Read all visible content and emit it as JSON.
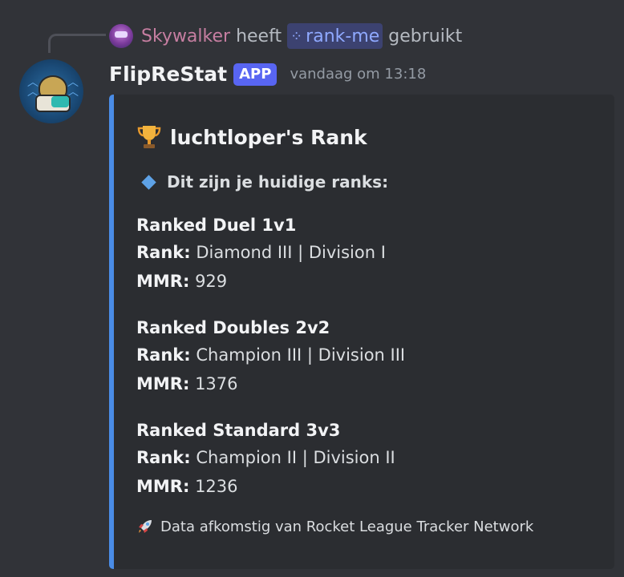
{
  "reply": {
    "user": "Skywalker",
    "verb": "heeft",
    "command": "rank-me",
    "used": "gebruikt"
  },
  "message": {
    "username": "FlipReStat",
    "badge": "APP",
    "timestamp": "vandaag om 13:18"
  },
  "embed": {
    "accent_color": "#4a8ce6",
    "title_icon": "trophy-icon",
    "title": "luchtloper's Rank",
    "subtitle_icon": "blue-diamond-icon",
    "subtitle": "Dit zijn je huidige ranks:",
    "rank_label": "Rank:",
    "mmr_label": "MMR:",
    "sections": [
      {
        "title": "Ranked Duel 1v1",
        "rank": "Diamond III | Division I",
        "mmr": "929"
      },
      {
        "title": "Ranked Doubles 2v2",
        "rank": "Champion III | Division III",
        "mmr": "1376"
      },
      {
        "title": "Ranked Standard 3v3",
        "rank": "Champion II | Division II",
        "mmr": "1236"
      }
    ],
    "footer_icon": "rocket-icon",
    "footer": "Data afkomstig van Rocket League Tracker Network"
  }
}
